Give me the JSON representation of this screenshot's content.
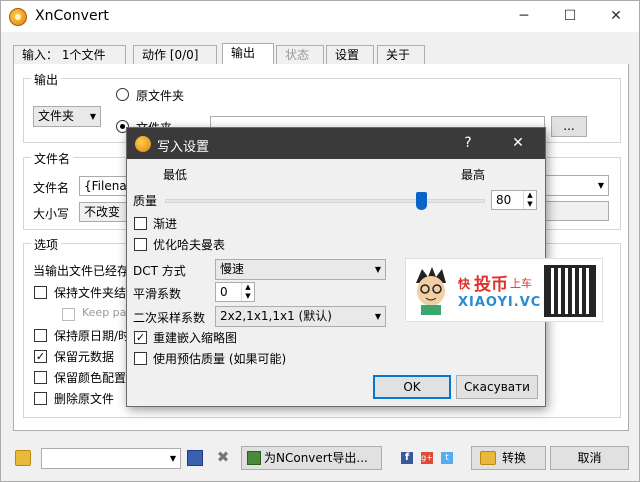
{
  "app": {
    "title": "XnConvert"
  },
  "tabs": [
    {
      "label": "输入： 1个文件"
    },
    {
      "label": "动作 [0/0]"
    },
    {
      "label": "输出"
    },
    {
      "label": "状态"
    },
    {
      "label": "设置"
    },
    {
      "label": "关于"
    }
  ],
  "output": {
    "group_label": "输出",
    "folder_select": "文件夹",
    "radio_source": "原文件夹",
    "radio_folder": "文件夹",
    "browse_label": "..."
  },
  "filename": {
    "group_label": "文件名",
    "name_label": "文件名",
    "name_value": "{Filena",
    "case_label": "大小写",
    "case_value": "不改变"
  },
  "options": {
    "group_label": "选项",
    "if_exists_label": "当输出文件已经存",
    "keep_structure": "保持文件夹结",
    "keep_parent": "Keep pa",
    "keep_date": "保持原日期/时",
    "keep_metadata": "保留元数据",
    "keep_color": "保留颜色配置",
    "delete_original": "删除原文件"
  },
  "dialog": {
    "title": "写入设置",
    "help": "?",
    "close": "✕",
    "low_label": "最低",
    "high_label": "最高",
    "quality_label": "质量",
    "quality_value": "80",
    "quality_fraction": 0.8,
    "progressive": "渐进",
    "optimize_huffman": "优化哈夫曼表",
    "dct_label": "DCT 方式",
    "dct_value": "慢速",
    "smoothing_label": "平滑系数",
    "smoothing_value": "0",
    "subsampling_label": "二次采样系数",
    "subsampling_value": "2x2,1x1,1x1 (默认)",
    "rebuild_thumb": "重建嵌入缩略图",
    "estimate_quality": "使用预估质量 (如果可能)",
    "ok_label": "OK",
    "cancel_label": "Скасувати"
  },
  "banner": {
    "text_fast": "快",
    "text_main": "投币",
    "text_car": "上车",
    "text_site": "XIAOYI.VC"
  },
  "bottom": {
    "export_label": "为NConvert导出...",
    "convert_label": "转换",
    "cancel_label": "取消"
  },
  "colors": {
    "accent": "#0078d7",
    "dialog_title_bg": "#3a3a3a",
    "slider_thumb": "#0a64c8",
    "banner_red": "#e0302a"
  }
}
